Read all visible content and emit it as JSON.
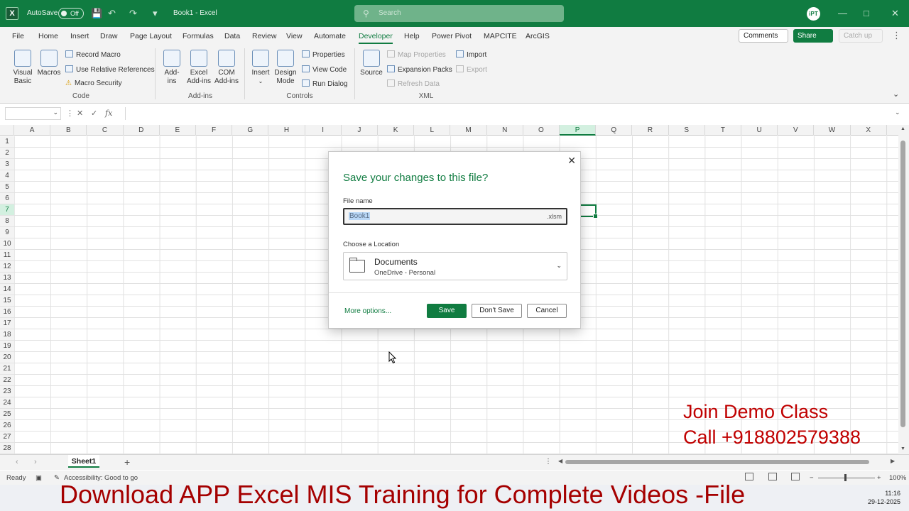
{
  "titlebar": {
    "logo": "X",
    "autosave_label": "AutoSave",
    "autosave_state": "Off",
    "doc_title": "Book1 - Excel",
    "search_placeholder": "Search",
    "avatar": "iPT"
  },
  "tabs": [
    "File",
    "Home",
    "Insert",
    "Draw",
    "Page Layout",
    "Formulas",
    "Data",
    "Review",
    "View",
    "Automate",
    "Developer",
    "Help",
    "Power Pivot",
    "MAPCITE",
    "ArcGIS"
  ],
  "active_tab": "Developer",
  "tab_actions": {
    "comments": "Comments",
    "share": "Share",
    "catchup": "Catch up"
  },
  "ribbon": {
    "code": {
      "label": "Code",
      "visual_basic": "Visual Basic",
      "macros": "Macros",
      "record_macro": "Record Macro",
      "relative_refs": "Use Relative References",
      "macro_security": "Macro Security"
    },
    "addins": {
      "label": "Add-ins",
      "addins": "Add-ins",
      "excel_addins": "Excel Add-ins",
      "com_addins": "COM Add-ins"
    },
    "controls": {
      "label": "Controls",
      "insert": "Insert",
      "design_mode": "Design Mode",
      "properties": "Properties",
      "view_code": "View Code",
      "run_dialog": "Run Dialog"
    },
    "xml": {
      "label": "XML",
      "source": "Source",
      "map_properties": "Map Properties",
      "expansion_packs": "Expansion Packs",
      "refresh_data": "Refresh Data",
      "import": "Import",
      "export": "Export"
    }
  },
  "grid": {
    "columns": [
      "A",
      "B",
      "C",
      "D",
      "E",
      "F",
      "G",
      "H",
      "I",
      "J",
      "K",
      "L",
      "M",
      "N",
      "O",
      "P",
      "Q",
      "R",
      "S",
      "T",
      "U",
      "V",
      "W",
      "X"
    ],
    "rows": [
      "1",
      "2",
      "3",
      "4",
      "5",
      "6",
      "7",
      "8",
      "9",
      "10",
      "11",
      "12",
      "13",
      "14",
      "15",
      "16",
      "17",
      "18",
      "19",
      "20",
      "21",
      "22",
      "23",
      "24",
      "25",
      "26",
      "27",
      "28"
    ],
    "active_column": "P",
    "active_row": "7"
  },
  "sheets": {
    "active": "Sheet1"
  },
  "statusbar": {
    "ready": "Ready",
    "accessibility": "Accessibility: Good to go",
    "zoom": "100%"
  },
  "taskbar": {
    "time": "11:16",
    "date": "29-12-2025"
  },
  "dialog": {
    "title": "Save your changes to this file?",
    "file_name_label": "File name",
    "file_name_value": "Book1",
    "file_ext": ".xlsm",
    "location_label": "Choose a Location",
    "location_name": "Documents",
    "location_sub": "OneDrive - Personal",
    "more_options": "More options...",
    "save": "Save",
    "dont_save": "Don't Save",
    "cancel": "Cancel"
  },
  "overlay": {
    "promo_line1": "Join Demo Class",
    "promo_line2": "Call +918802579388",
    "banner": "Download APP Excel MIS Training for Complete Videos -File"
  },
  "colors": {
    "accent": "#107c41",
    "overlay_text": "#c00000"
  }
}
